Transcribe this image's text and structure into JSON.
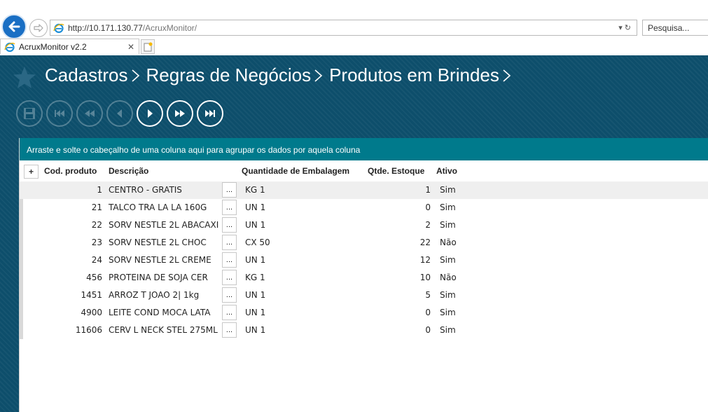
{
  "browser": {
    "url_host": "http://10.171.130.77",
    "url_path": "/AcruxMonitor/",
    "url_controls": "▾ ↻",
    "search_placeholder": "Pesquisa...",
    "tab_title": "AcruxMonitor v2.2",
    "tab_close": "✕"
  },
  "breadcrumb": [
    "Cadastros",
    "Regras de Negócios",
    "Produtos em Brindes"
  ],
  "toolbar": {
    "buttons": [
      "save-icon",
      "first-record-icon",
      "prev-page-icon",
      "prev-record-icon",
      "next-record-icon",
      "next-page-icon",
      "last-record-icon"
    ]
  },
  "grid": {
    "group_hint": "Arraste e solte o cabeçalho de uma coluna aqui para agrupar os dados por aquela coluna",
    "expand_label": "+",
    "columns": [
      "Cod. produto",
      "Descrição",
      "Quantidade de Embalagem",
      "Qtde. Estoque",
      "Ativo"
    ],
    "dots_label": "...",
    "rows": [
      {
        "code": "1",
        "desc": "CENTRO - GRATIS",
        "emb": "KG 1",
        "est": "1",
        "ativo": "Sim"
      },
      {
        "code": "21",
        "desc": "TALCO TRA LA LA 160G",
        "emb": "UN 1",
        "est": "0",
        "ativo": "Sim"
      },
      {
        "code": "22",
        "desc": "SORV NESTLE 2L ABACAXI",
        "emb": "UN 1",
        "est": "2",
        "ativo": "Sim"
      },
      {
        "code": "23",
        "desc": "SORV NESTLE 2L CHOC",
        "emb": "CX 50",
        "est": "22",
        "ativo": "Não"
      },
      {
        "code": "24",
        "desc": "SORV NESTLE 2L CREME",
        "emb": "UN 1",
        "est": "12",
        "ativo": "Sim"
      },
      {
        "code": "456",
        "desc": "PROTEINA DE SOJA CER",
        "emb": "KG 1",
        "est": "10",
        "ativo": "Não"
      },
      {
        "code": "1451",
        "desc": "ARROZ T JOAO 2| 1kg",
        "emb": "UN 1",
        "est": "5",
        "ativo": "Sim"
      },
      {
        "code": "4900",
        "desc": "LEITE COND MOCA LATA",
        "emb": "UN 1",
        "est": "0",
        "ativo": "Sim"
      },
      {
        "code": "11606",
        "desc": "CERV L NECK STEL 275ML",
        "emb": "UN 1",
        "est": "0",
        "ativo": "Sim"
      }
    ]
  },
  "colors": {
    "app_bg": "#0d4e6b",
    "group_bar": "#007a8c",
    "selected_row": "#efefef"
  }
}
